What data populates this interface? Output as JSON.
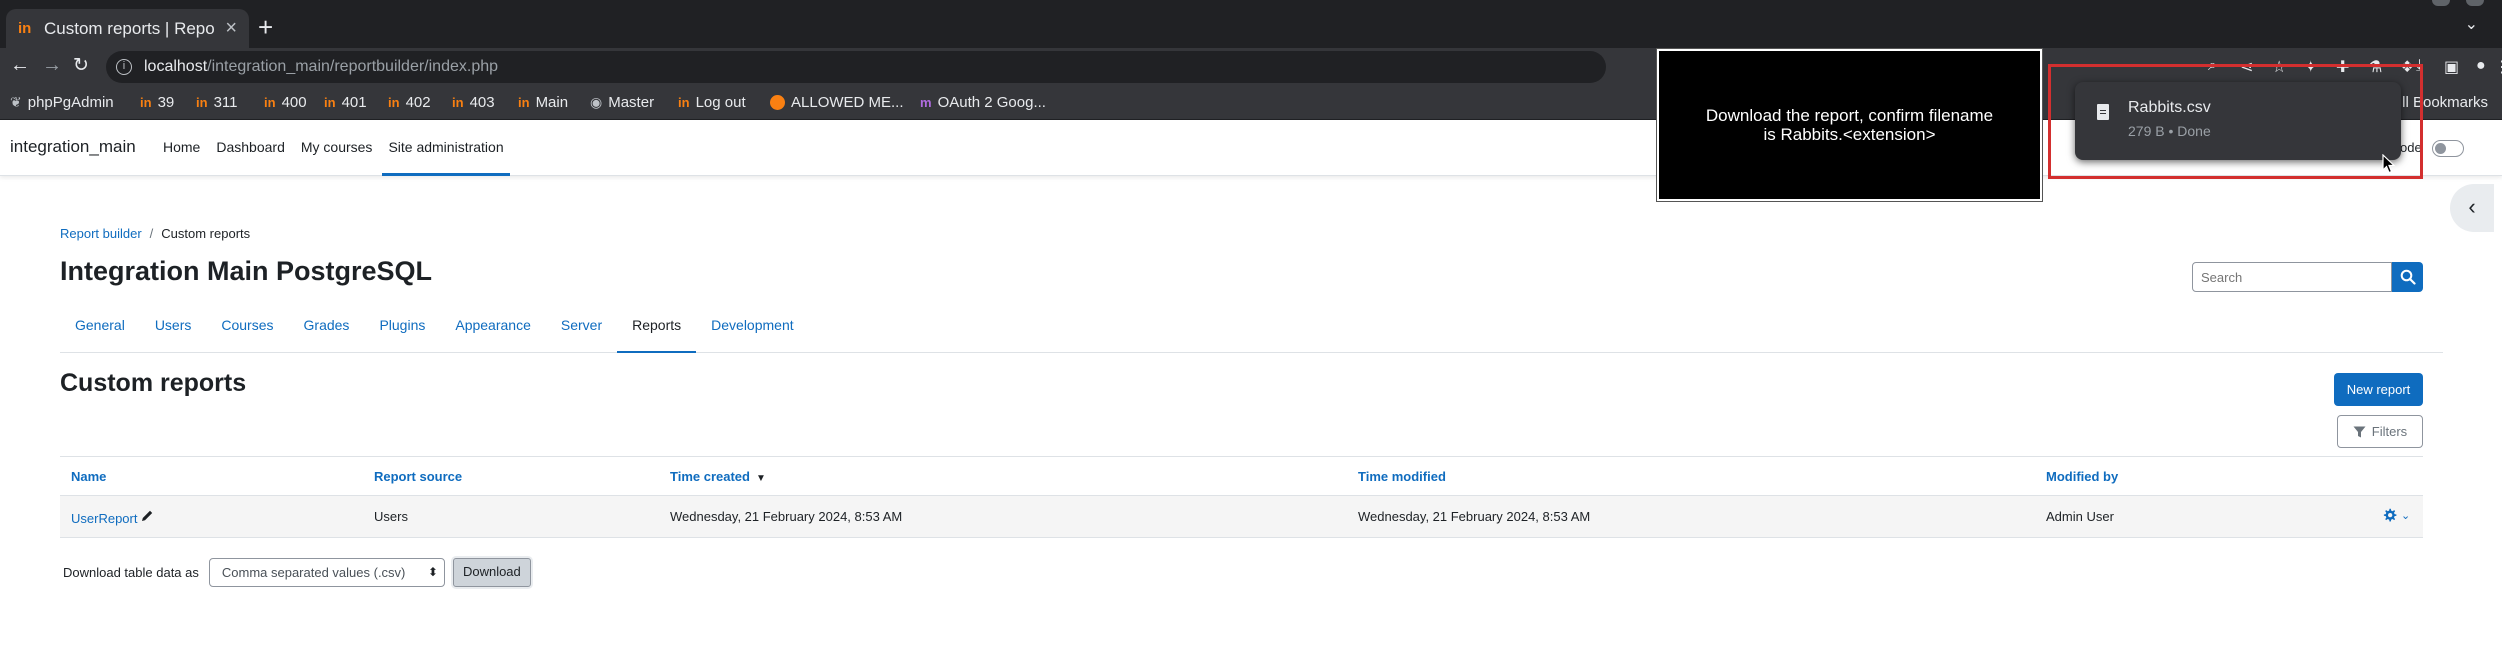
{
  "browser": {
    "tab_title": "Custom reports | Report b",
    "tab_favicon": "in",
    "new_tab": "+",
    "url_host": "localhost",
    "url_path": "/integration_main/reportbuilder/index.php",
    "bookmarks": [
      {
        "label": "phpPgAdmin",
        "icon": "elephant-icon"
      },
      {
        "label": "39",
        "icon": "moodle-icon"
      },
      {
        "label": "311",
        "icon": "moodle-icon"
      },
      {
        "label": "400",
        "icon": "moodle-icon"
      },
      {
        "label": "401",
        "icon": "moodle-icon"
      },
      {
        "label": "402",
        "icon": "moodle-icon"
      },
      {
        "label": "403",
        "icon": "moodle-icon"
      },
      {
        "label": "Main",
        "icon": "moodle-icon"
      },
      {
        "label": "Master",
        "icon": "github-icon"
      },
      {
        "label": "Log out",
        "icon": "moodle-icon"
      },
      {
        "label": "ALLOWED ME...",
        "icon": "orange-circle-icon"
      },
      {
        "label": "OAuth 2 Goog...",
        "icon": "purple-moodle-icon"
      }
    ],
    "all_bookmarks": "ll Bookmarks"
  },
  "navbar": {
    "brand": "integration_main",
    "items": [
      {
        "label": "Home"
      },
      {
        "label": "Dashboard"
      },
      {
        "label": "My courses"
      },
      {
        "label": "Site administration"
      }
    ],
    "edit_mode_label": "ode"
  },
  "breadcrumb": {
    "link": "Report builder",
    "separator": "/",
    "current": "Custom reports"
  },
  "page_title": "Integration Main PostgreSQL",
  "search": {
    "placeholder": "Search"
  },
  "secondary_nav": [
    {
      "label": "General"
    },
    {
      "label": "Users"
    },
    {
      "label": "Courses"
    },
    {
      "label": "Grades"
    },
    {
      "label": "Plugins"
    },
    {
      "label": "Appearance"
    },
    {
      "label": "Server"
    },
    {
      "label": "Reports"
    },
    {
      "label": "Development"
    }
  ],
  "section_title": "Custom reports",
  "new_report_label": "New report",
  "filters_label": "Filters",
  "table": {
    "headers": {
      "name": "Name",
      "source": "Report source",
      "created": "Time created",
      "modified": "Time modified",
      "modified_by": "Modified by"
    },
    "rows": [
      {
        "name": "UserReport",
        "source": "Users",
        "created": "Wednesday, 21 February 2024, 8:53 AM",
        "modified": "Wednesday, 21 February 2024, 8:53 AM",
        "modified_by": "Admin User"
      }
    ]
  },
  "download": {
    "label": "Download table data as",
    "selected": "Comma separated values (.csv)",
    "button": "Download"
  },
  "instruction": "Download the report, confirm filename is Rabbits.<extension>",
  "download_bubble": {
    "filename": "Rabbits.csv",
    "meta": "279 B • Done"
  },
  "colors": {
    "moodle_blue": "#0f6cbf",
    "highlight_red": "#d32f2f",
    "chrome_dark": "#35363a"
  }
}
